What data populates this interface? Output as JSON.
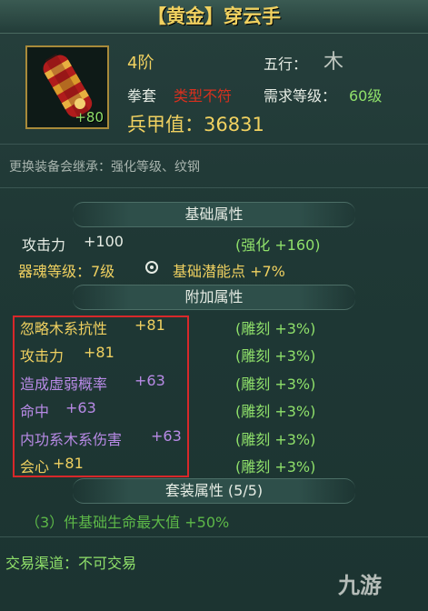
{
  "title": "【黄金】穿云手",
  "item": {
    "icon_name": "red-gold-gauntlet-icon",
    "icon_bonus": "+80",
    "grade": "4阶",
    "wuxing_label": "五行：",
    "wuxing_value": "木",
    "category": "拳套",
    "category_warning": "类型不符",
    "required_level_label": "需求等级：",
    "required_level_value": "60级",
    "power_label": "兵甲值：",
    "power_value": "36831"
  },
  "inherit_note": "更换装备会继承：强化等级、纹钢",
  "basic_section": {
    "title": "基础属性",
    "attack_name": "攻击力",
    "attack_value": "+100",
    "attack_bonus": "(强化 +160)",
    "soul_level": "器魂等级：7级",
    "potential": "基础潜能点 +7%"
  },
  "extra_section": {
    "title": "附加属性",
    "rows": [
      {
        "name": "忽略木系抗性",
        "value": "+81",
        "bonus": "(雕刻 +3%)",
        "color": "#f0d160"
      },
      {
        "name": "攻击力",
        "value": "+81",
        "bonus": "(雕刻 +3%)",
        "color": "#f0d160"
      },
      {
        "name": "造成虚弱概率",
        "value": "+63",
        "bonus": "(雕刻 +3%)",
        "color": "#b88ae6"
      },
      {
        "name": "命中",
        "value": "+63",
        "bonus": "(雕刻 +3%)",
        "color": "#b88ae6"
      },
      {
        "name": "内功系木系伤害",
        "value": "+63",
        "bonus": "(雕刻 +3%)",
        "color": "#b88ae6"
      },
      {
        "name": "会心",
        "value": "+81",
        "bonus": "(雕刻 +3%)",
        "color": "#f0d160"
      }
    ]
  },
  "set_section": {
    "title": "套装属性 (5/5)",
    "row": "（3）件基础生命最大值  +50%"
  },
  "footer": "交易渠道：不可交易",
  "watermark": "九游",
  "colors": {
    "gold": "#f0d160",
    "green": "#8fe06a",
    "purple": "#b88ae6",
    "red": "#d8301e"
  }
}
